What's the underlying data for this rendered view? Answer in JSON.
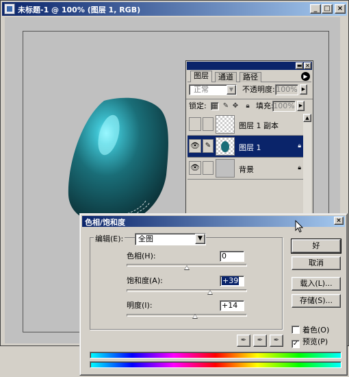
{
  "document_window": {
    "title": "未标题-1 @ 100% (图层 1, RGB)",
    "controls": {
      "minimize": "_",
      "restore": "□",
      "close": "×"
    }
  },
  "layers_palette": {
    "tabs": [
      {
        "label": "图层",
        "active": true
      },
      {
        "label": "通道",
        "active": false
      },
      {
        "label": "路径",
        "active": false
      }
    ],
    "blend_mode": "正常",
    "opacity_label": "不透明度:",
    "opacity_value": "100%",
    "lock_label": "锁定:",
    "fill_label": "填充:",
    "fill_value": "100%",
    "layers": [
      {
        "name": "图层 1 副本",
        "visible": false,
        "selected": false,
        "locked": false
      },
      {
        "name": "图层 1",
        "visible": true,
        "selected": true,
        "locked": true
      },
      {
        "name": "背景",
        "visible": true,
        "selected": false,
        "locked": true
      }
    ]
  },
  "hue_saturation_dialog": {
    "title": "色相/饱和度",
    "edit_label": "编辑(E):",
    "edit_value": "全图",
    "sliders": [
      {
        "label": "色相(H):",
        "value": "0",
        "position": 0.5
      },
      {
        "label": "饱和度(A):",
        "value": "+39",
        "position": 0.695
      },
      {
        "label": "明度(I):",
        "value": "+14",
        "position": 0.57
      }
    ],
    "buttons": {
      "ok": "好",
      "cancel": "取消",
      "load": "载入(L)...",
      "save": "存储(S)..."
    },
    "colorize_label": "着色(O)",
    "colorize_checked": false,
    "preview_label": "预览(P)",
    "preview_checked": true
  },
  "colors": {
    "titlebar_start": "#0a246a",
    "titlebar_end": "#a6caf0",
    "selection": "#0a246a",
    "egg_base": "#1a5f68",
    "egg_highlight": "#7fe8f5"
  }
}
